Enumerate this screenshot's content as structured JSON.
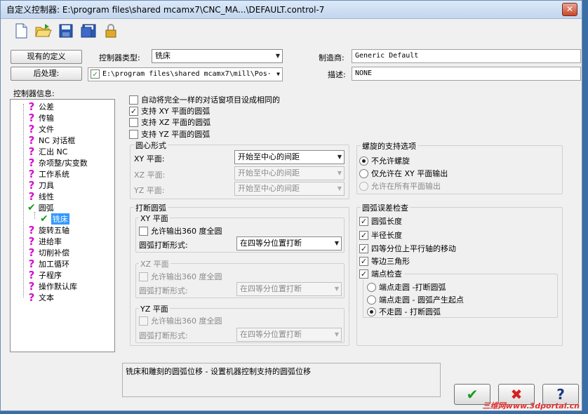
{
  "window": {
    "title": "自定义控制器: E:\\program files\\shared mcamx7\\CNC_MA...\\DEFAULT.control-7",
    "close_icon": "close-icon"
  },
  "toolbar": {
    "icons": [
      "new-file-icon",
      "open-folder-icon",
      "save-icon",
      "save-as-icon",
      "lock-icon"
    ]
  },
  "top": {
    "existing_def_label": "现有的定义",
    "post_label": "后处理:",
    "controller_type_label": "控制器类型:",
    "controller_type_value": "铣床",
    "post_path": "E:\\program files\\shared mcamx7\\mill\\Pos·",
    "manufacturer_label": "制造商:",
    "manufacturer_value": "Generic Default",
    "description_label": "描述:",
    "description_value": "NONE"
  },
  "tree": {
    "header": "控制器信息:",
    "items": [
      "公差",
      "传输",
      "文件",
      "NC 对话框",
      "汇出 NC",
      "杂项整/实变数",
      "工作系统",
      "刀具",
      "线性",
      "圆弧",
      "铣床",
      "旋转五轴",
      "进给率",
      "切削补偿",
      "加工循环",
      "子程序",
      "操作默认库",
      "文本"
    ]
  },
  "options": {
    "auto_same": "自动将完全一样的对话窗项目设成相同的",
    "xy": "支持 XY 平面的圆弧",
    "xz": "支持 XZ 平面的圆弧",
    "yz": "支持 YZ 平面的圆弧",
    "xy_checked": true
  },
  "center": {
    "title": "圆心形式",
    "xy_label": "XY 平面:",
    "xz_label": "XZ 平面:",
    "yz_label": "YZ 平面:",
    "value": "开始至中心的间距"
  },
  "break": {
    "title": "打断圆弧",
    "xy_plane": "XY 平面",
    "xz_plane": "XZ 平面",
    "yz_plane": "YZ 平面",
    "allow360": "允许输出360 度全圆",
    "form_label": "圆弧打断形式:",
    "form_value": "在四等分位置打断"
  },
  "helix": {
    "title": "螺旋的支持选项",
    "opt1": "不允许螺旋",
    "opt2": "仅允许在 XY 平面输出",
    "opt3": "允许在所有平面输出"
  },
  "tolerance": {
    "title": "圆弧误差检查",
    "arc_length": "圆弧长度",
    "radius_length": "半径长度",
    "quadrant_move": "四等分位上平行轴的移动",
    "isosceles": "等边三角形",
    "endpoint": "端点检查",
    "ep1": "端点走圆 -打断圆弧",
    "ep2": "端点走圆 - 圆弧产生起点",
    "ep3": "不走圆 - 打断圆弧"
  },
  "footer": {
    "description_text": "铣床和雕刻的圆弧位移 - 设置机器控制支持的圆弧位移",
    "ok_icon": "check-icon",
    "cancel_icon": "x-icon",
    "help_icon": "question-icon",
    "watermark": "三维网www.3dportal.cn"
  },
  "colors": {
    "question": "#d40fd0",
    "check": "#1c9a1c",
    "cancel": "#d62020"
  }
}
